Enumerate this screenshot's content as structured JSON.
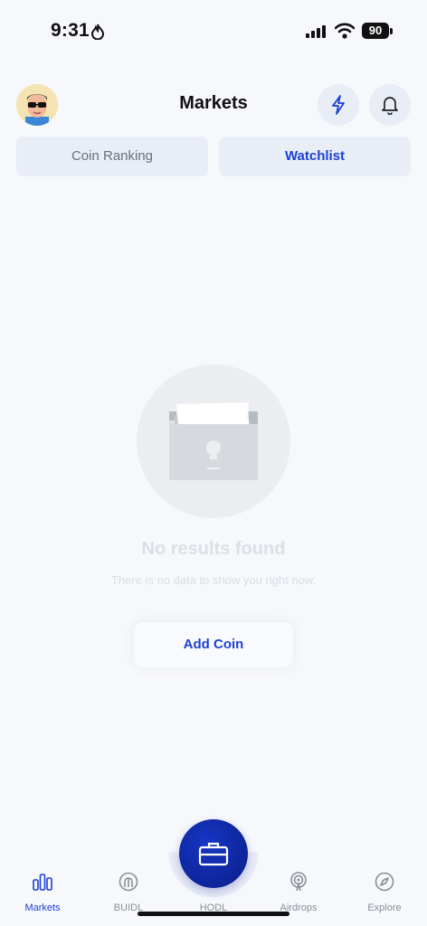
{
  "status": {
    "time": "9:31",
    "battery": "90"
  },
  "header": {
    "title": "Markets"
  },
  "tabs": [
    {
      "label": "Coin Ranking",
      "active": false
    },
    {
      "label": "Watchlist",
      "active": true
    }
  ],
  "empty_state": {
    "title": "No results found",
    "subtitle": "There is no data to show you right now.",
    "action_label": "Add Coin"
  },
  "nav": [
    {
      "label": "Markets",
      "icon": "bar-chart-icon",
      "active": true
    },
    {
      "label": "BUIDL",
      "icon": "buidl-icon",
      "active": false
    },
    {
      "label": "HODL",
      "icon": "briefcase-icon",
      "active": false
    },
    {
      "label": "Airdrops",
      "icon": "airdrops-icon",
      "active": false
    },
    {
      "label": "Explore",
      "icon": "compass-icon",
      "active": false
    }
  ],
  "colors": {
    "accent": "#1b3fd6",
    "fab": "#0d23a0",
    "background": "#f7f8fc"
  }
}
